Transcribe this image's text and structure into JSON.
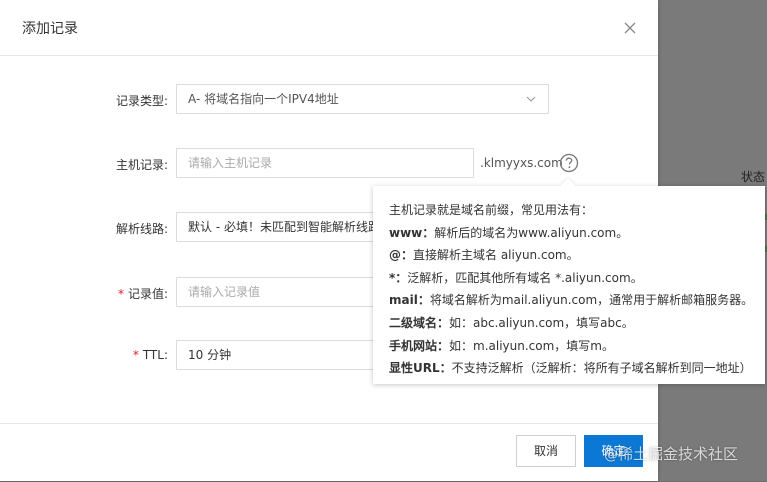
{
  "dialog": {
    "title": "添加记录"
  },
  "form": {
    "record_type": {
      "label": "记录类型:",
      "value": "A- 将域名指向一个IPV4地址"
    },
    "host": {
      "label": "主机记录:",
      "placeholder": "请输入主机记录",
      "suffix": ".klmyyxs.com"
    },
    "line": {
      "label": "解析线路:",
      "value": "默认 - 必填！未匹配到智能解析线路"
    },
    "value": {
      "label": "记录值:",
      "required_mark": "*",
      "placeholder": "请输入记录值"
    },
    "ttl": {
      "label": "TTL:",
      "required_mark": "*",
      "value": "10 分钟"
    }
  },
  "tooltip": {
    "intro": "主机记录就是域名前缀，常见用法有：",
    "items": [
      {
        "key": "www：",
        "text": "解析后的域名为www.aliyun.com。"
      },
      {
        "key": "@：",
        "text": "直接解析主域名 aliyun.com。"
      },
      {
        "key": "*：",
        "text": "泛解析，匹配其他所有域名 *.aliyun.com。"
      },
      {
        "key": "mail：",
        "text": "将域名解析为mail.aliyun.com，通常用于解析邮箱服务器。"
      },
      {
        "key": "二级域名：",
        "text": "如：abc.aliyun.com，填写abc。"
      },
      {
        "key": "手机网站：",
        "text": "如：m.aliyun.com，填写m。"
      },
      {
        "key": "显性URL：",
        "text": "不支持泛解析（泛解析：将所有子域名解析到同一地址）"
      }
    ]
  },
  "footer": {
    "cancel_label": "取消",
    "ok_label": "确定"
  },
  "background": {
    "status_text": "状态"
  },
  "watermark": {
    "at": "@",
    "text": "稀土掘金技术社区"
  },
  "colors": {
    "primary": "#0a78d4",
    "required": "#e02020"
  }
}
